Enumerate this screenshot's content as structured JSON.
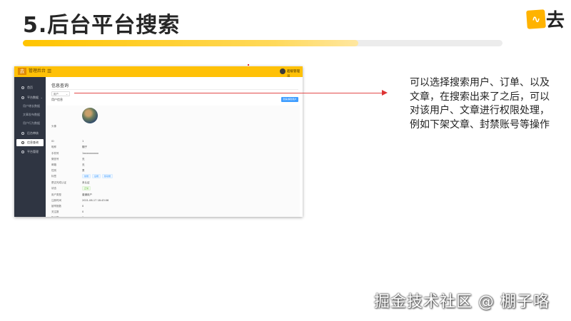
{
  "slide": {
    "title": "5.后台平台搜索",
    "progress": 0.7
  },
  "brand": {
    "logo_text": "去",
    "accent": "#ffc107"
  },
  "app": {
    "name": "管理后台",
    "menu_icon": "hamburger-icon",
    "user_name": "超级管理员",
    "sidebar": [
      {
        "label": "首页"
      },
      {
        "label": "平台数据"
      },
      {
        "label": "用户增长数据"
      },
      {
        "label": "文章发布数据"
      },
      {
        "label": "用户行为数据"
      },
      {
        "label": "后台审核"
      },
      {
        "label": "信息查询"
      },
      {
        "label": "平台管理"
      }
    ],
    "page_title": "信息查询",
    "search_select": "用户",
    "result_label": "用户信息",
    "action_button": "封禁/解封用户",
    "fields": [
      {
        "label": "头像",
        "value": ""
      },
      {
        "label": "ID",
        "value": "1"
      },
      {
        "label": "昵称",
        "value": "棚子"
      },
      {
        "label": "手机号",
        "value": "1xxxxxxxxxx"
      },
      {
        "label": "微信号",
        "value": "无"
      },
      {
        "label": "邮箱",
        "value": "无"
      },
      {
        "label": "性别",
        "value": "男"
      },
      {
        "label": "标签",
        "value": "",
        "tags": [
          "前端",
          "后端",
          "移动端"
        ]
      },
      {
        "label": "是否完成认证",
        "value": "未认证"
      },
      {
        "label": "状态",
        "value": "",
        "tags": [
          "正常"
        ]
      },
      {
        "label": "用户类型",
        "value": "普通用户"
      },
      {
        "label": "注册时间",
        "value": "2021-06-17 18:43:06"
      },
      {
        "label": "被举报数",
        "value": "0"
      },
      {
        "label": "关注数",
        "value": "0"
      },
      {
        "label": "粉丝数",
        "value": "0"
      }
    ]
  },
  "description": "可以选择搜索用户、订单、以及文章，在搜索出来了之后，可以对该用户、文章进行权限处理，例如下架文章、封禁账号等操作",
  "watermark": "掘金技术社区 @ 棚子咯"
}
